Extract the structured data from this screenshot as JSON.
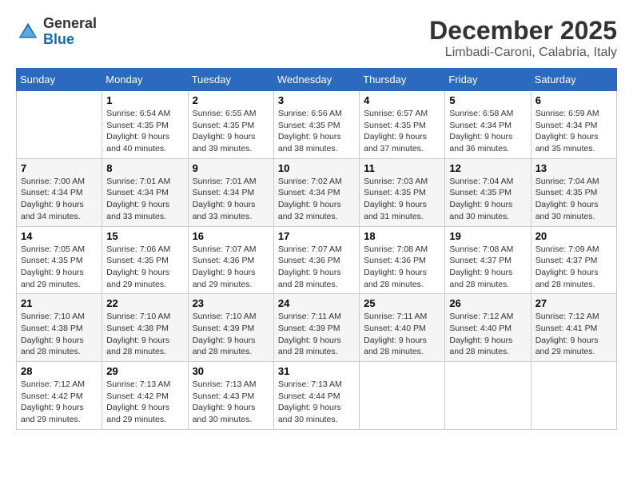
{
  "logo": {
    "general": "General",
    "blue": "Blue"
  },
  "header": {
    "month": "December 2025",
    "location": "Limbadi-Caroni, Calabria, Italy"
  },
  "weekdays": [
    "Sunday",
    "Monday",
    "Tuesday",
    "Wednesday",
    "Thursday",
    "Friday",
    "Saturday"
  ],
  "weeks": [
    [
      {
        "day": "",
        "info": ""
      },
      {
        "day": "1",
        "info": "Sunrise: 6:54 AM\nSunset: 4:35 PM\nDaylight: 9 hours\nand 40 minutes."
      },
      {
        "day": "2",
        "info": "Sunrise: 6:55 AM\nSunset: 4:35 PM\nDaylight: 9 hours\nand 39 minutes."
      },
      {
        "day": "3",
        "info": "Sunrise: 6:56 AM\nSunset: 4:35 PM\nDaylight: 9 hours\nand 38 minutes."
      },
      {
        "day": "4",
        "info": "Sunrise: 6:57 AM\nSunset: 4:35 PM\nDaylight: 9 hours\nand 37 minutes."
      },
      {
        "day": "5",
        "info": "Sunrise: 6:58 AM\nSunset: 4:34 PM\nDaylight: 9 hours\nand 36 minutes."
      },
      {
        "day": "6",
        "info": "Sunrise: 6:59 AM\nSunset: 4:34 PM\nDaylight: 9 hours\nand 35 minutes."
      }
    ],
    [
      {
        "day": "7",
        "info": "Sunrise: 7:00 AM\nSunset: 4:34 PM\nDaylight: 9 hours\nand 34 minutes."
      },
      {
        "day": "8",
        "info": "Sunrise: 7:01 AM\nSunset: 4:34 PM\nDaylight: 9 hours\nand 33 minutes."
      },
      {
        "day": "9",
        "info": "Sunrise: 7:01 AM\nSunset: 4:34 PM\nDaylight: 9 hours\nand 33 minutes."
      },
      {
        "day": "10",
        "info": "Sunrise: 7:02 AM\nSunset: 4:34 PM\nDaylight: 9 hours\nand 32 minutes."
      },
      {
        "day": "11",
        "info": "Sunrise: 7:03 AM\nSunset: 4:35 PM\nDaylight: 9 hours\nand 31 minutes."
      },
      {
        "day": "12",
        "info": "Sunrise: 7:04 AM\nSunset: 4:35 PM\nDaylight: 9 hours\nand 30 minutes."
      },
      {
        "day": "13",
        "info": "Sunrise: 7:04 AM\nSunset: 4:35 PM\nDaylight: 9 hours\nand 30 minutes."
      }
    ],
    [
      {
        "day": "14",
        "info": "Sunrise: 7:05 AM\nSunset: 4:35 PM\nDaylight: 9 hours\nand 29 minutes."
      },
      {
        "day": "15",
        "info": "Sunrise: 7:06 AM\nSunset: 4:35 PM\nDaylight: 9 hours\nand 29 minutes."
      },
      {
        "day": "16",
        "info": "Sunrise: 7:07 AM\nSunset: 4:36 PM\nDaylight: 9 hours\nand 29 minutes."
      },
      {
        "day": "17",
        "info": "Sunrise: 7:07 AM\nSunset: 4:36 PM\nDaylight: 9 hours\nand 28 minutes."
      },
      {
        "day": "18",
        "info": "Sunrise: 7:08 AM\nSunset: 4:36 PM\nDaylight: 9 hours\nand 28 minutes."
      },
      {
        "day": "19",
        "info": "Sunrise: 7:08 AM\nSunset: 4:37 PM\nDaylight: 9 hours\nand 28 minutes."
      },
      {
        "day": "20",
        "info": "Sunrise: 7:09 AM\nSunset: 4:37 PM\nDaylight: 9 hours\nand 28 minutes."
      }
    ],
    [
      {
        "day": "21",
        "info": "Sunrise: 7:10 AM\nSunset: 4:38 PM\nDaylight: 9 hours\nand 28 minutes."
      },
      {
        "day": "22",
        "info": "Sunrise: 7:10 AM\nSunset: 4:38 PM\nDaylight: 9 hours\nand 28 minutes."
      },
      {
        "day": "23",
        "info": "Sunrise: 7:10 AM\nSunset: 4:39 PM\nDaylight: 9 hours\nand 28 minutes."
      },
      {
        "day": "24",
        "info": "Sunrise: 7:11 AM\nSunset: 4:39 PM\nDaylight: 9 hours\nand 28 minutes."
      },
      {
        "day": "25",
        "info": "Sunrise: 7:11 AM\nSunset: 4:40 PM\nDaylight: 9 hours\nand 28 minutes."
      },
      {
        "day": "26",
        "info": "Sunrise: 7:12 AM\nSunset: 4:40 PM\nDaylight: 9 hours\nand 28 minutes."
      },
      {
        "day": "27",
        "info": "Sunrise: 7:12 AM\nSunset: 4:41 PM\nDaylight: 9 hours\nand 29 minutes."
      }
    ],
    [
      {
        "day": "28",
        "info": "Sunrise: 7:12 AM\nSunset: 4:42 PM\nDaylight: 9 hours\nand 29 minutes."
      },
      {
        "day": "29",
        "info": "Sunrise: 7:13 AM\nSunset: 4:42 PM\nDaylight: 9 hours\nand 29 minutes."
      },
      {
        "day": "30",
        "info": "Sunrise: 7:13 AM\nSunset: 4:43 PM\nDaylight: 9 hours\nand 30 minutes."
      },
      {
        "day": "31",
        "info": "Sunrise: 7:13 AM\nSunset: 4:44 PM\nDaylight: 9 hours\nand 30 minutes."
      },
      {
        "day": "",
        "info": ""
      },
      {
        "day": "",
        "info": ""
      },
      {
        "day": "",
        "info": ""
      }
    ]
  ]
}
